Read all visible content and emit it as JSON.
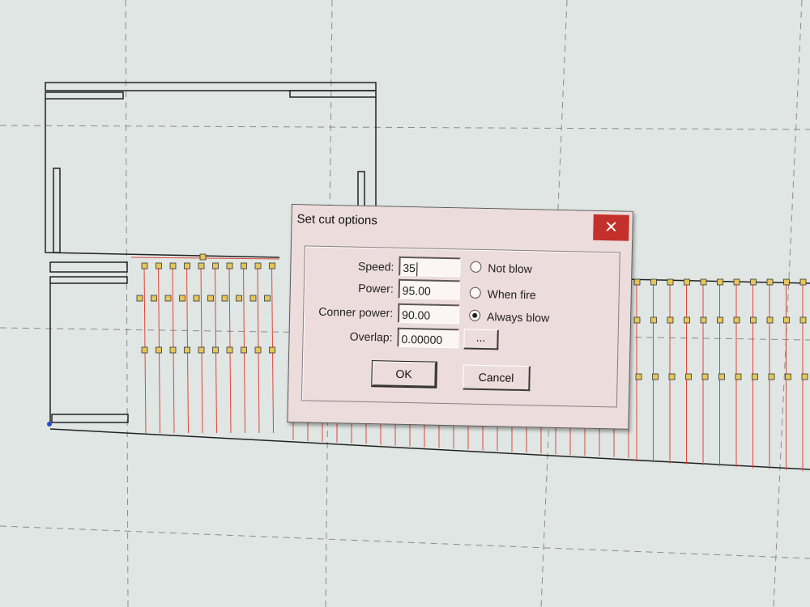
{
  "dialog": {
    "title": "Set cut options",
    "close_glyph": "✕",
    "fields": {
      "speed": {
        "label": "Speed:",
        "value": "35"
      },
      "power": {
        "label": "Power:",
        "value": "95.00"
      },
      "corner_power": {
        "label": "Conner power:",
        "value": "90.00"
      },
      "overlap": {
        "label": "Overlap:",
        "value": "0.00000"
      }
    },
    "blow_options": [
      {
        "label": "Not blow",
        "selected": false
      },
      {
        "label": "When fire",
        "selected": false
      },
      {
        "label": "Always blow",
        "selected": true
      }
    ],
    "ellipsis_button": "...",
    "ok_button": "OK",
    "cancel_button": "Cancel"
  },
  "colors": {
    "canvas_bg": "#dfe6e4",
    "cut_line": "#e0463a",
    "node_fill": "#e5c65a",
    "outline": "#222222",
    "grid": "#8c8c8c"
  }
}
